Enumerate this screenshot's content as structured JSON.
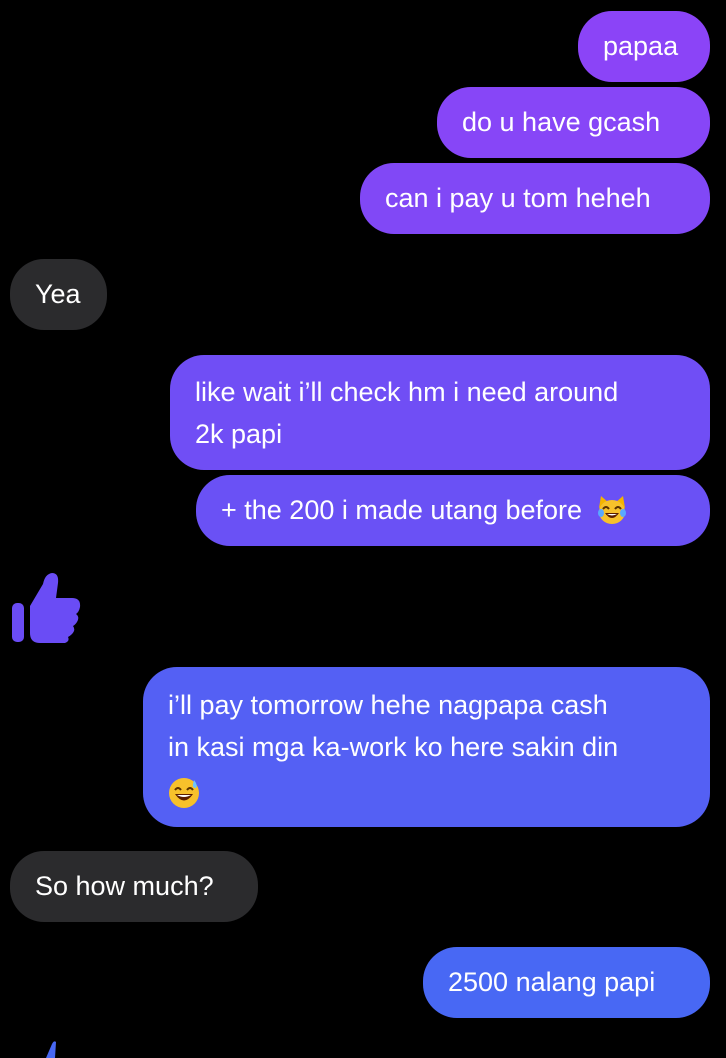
{
  "colors": {
    "background": "#000000",
    "incoming_bubble": "#2b2b2d",
    "outgoing_top": "#8a45f7",
    "outgoing_bottom": "#4568f4",
    "like_icon": "#6a4cf5"
  },
  "messages": [
    {
      "id": "m1",
      "direction": "outgoing",
      "text": "papaa",
      "color": "#8b44f7"
    },
    {
      "id": "m2",
      "direction": "outgoing",
      "text": "do u have gcash",
      "color": "#8746f7"
    },
    {
      "id": "m3",
      "direction": "outgoing",
      "text": "can i pay u tom heheh",
      "color": "#8148f6"
    },
    {
      "id": "m4",
      "direction": "incoming",
      "text": "Yea"
    },
    {
      "id": "m5",
      "direction": "outgoing",
      "line1": "like wait i’ll check hm i need around",
      "line2": "2k papi",
      "color": "#704ef5"
    },
    {
      "id": "m6",
      "direction": "outgoing",
      "text": "+ the 200 i made utang before",
      "emoji": "cat-tears-of-joy-emoji",
      "color": "#6a51f5"
    },
    {
      "id": "m7",
      "direction": "incoming",
      "type": "like",
      "icon": "thumbs-up-icon"
    },
    {
      "id": "m8",
      "direction": "outgoing",
      "line1": "i’ll pay tomorrow hehe nagpapa cash",
      "line2": "in kasi mga ka-work ko here sakin din",
      "emoji": "grinning-sweat-emoji",
      "color": "#5460f4"
    },
    {
      "id": "m9",
      "direction": "incoming",
      "text": "So how much?"
    },
    {
      "id": "m10",
      "direction": "outgoing",
      "text": "2500 nalang papi",
      "color": "#4868f4"
    }
  ]
}
